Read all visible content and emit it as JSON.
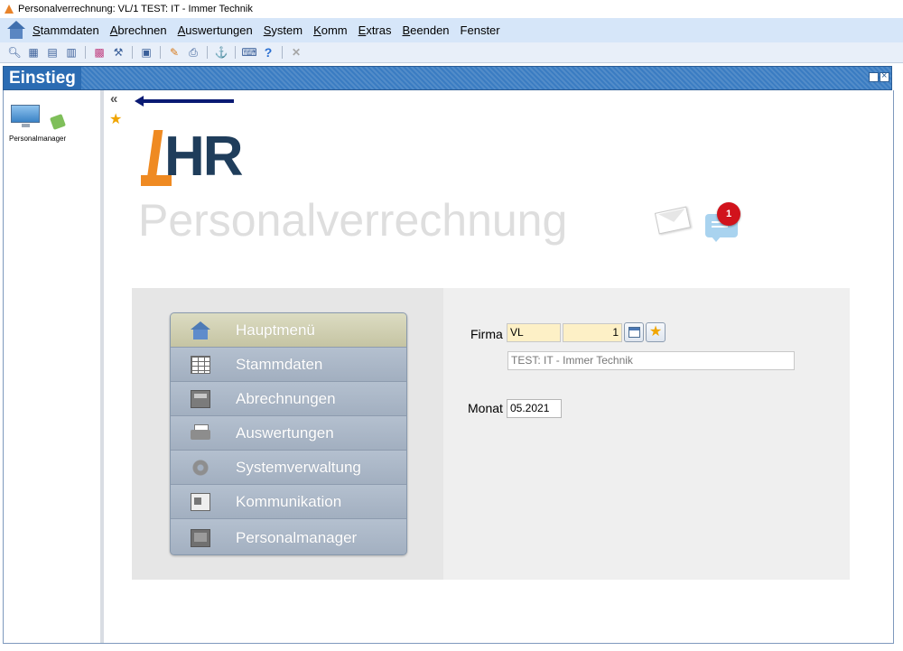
{
  "window": {
    "title": "Personalverrechnung: VL/1 TEST: IT - Immer Technik"
  },
  "menubar": {
    "items": [
      {
        "underline": "S",
        "rest": "tammdaten"
      },
      {
        "underline": "A",
        "rest": "brechnen"
      },
      {
        "underline": "A",
        "rest": "uswertungen"
      },
      {
        "underline": "S",
        "rest": "ystem"
      },
      {
        "underline": "K",
        "rest": "omm"
      },
      {
        "underline": "E",
        "rest": "xtras"
      },
      {
        "underline": "B",
        "rest": "eenden"
      },
      {
        "underline": "",
        "rest": "Fenster"
      }
    ]
  },
  "toolbar": {
    "icons": [
      "search-icon",
      "grid-icon",
      "new-document-icon",
      "document-icon",
      "color-grid-icon",
      "tools-icon",
      "user-card-icon",
      "edit-icon",
      "print-preview-icon",
      "anchor-icon",
      "keyboard-icon",
      "help-icon",
      "close-icon"
    ]
  },
  "panel": {
    "title": "Einstieg"
  },
  "sidebar": {
    "items": [
      {
        "label": "Personalmanager",
        "icon": "monitor-icon"
      }
    ]
  },
  "brand": {
    "logo_text": "HR",
    "product_title": "Personalverrechnung",
    "notification_count": "1",
    "accent_orange": "#ef8a22",
    "accent_navy": "#1f3d5b"
  },
  "main_menu": {
    "items": [
      {
        "label": "Hauptmenü",
        "icon": "home-icon",
        "active": true
      },
      {
        "label": "Stammdaten",
        "icon": "table-icon",
        "active": false
      },
      {
        "label": "Abrechnungen",
        "icon": "calculator-icon",
        "active": false
      },
      {
        "label": "Auswertungen",
        "icon": "printer-icon",
        "active": false
      },
      {
        "label": "Systemverwaltung",
        "icon": "gear-icon",
        "active": false
      },
      {
        "label": "Kommunikation",
        "icon": "communication-icon",
        "active": false
      },
      {
        "label": "Personalmanager",
        "icon": "personalmanager-icon",
        "active": false
      }
    ]
  },
  "form": {
    "firma_label": "Firma",
    "firma_code": "VL",
    "firma_number": "1",
    "firma_name": "TEST: IT - Immer Technik",
    "monat_label": "Monat",
    "monat_value": "05.2021"
  }
}
